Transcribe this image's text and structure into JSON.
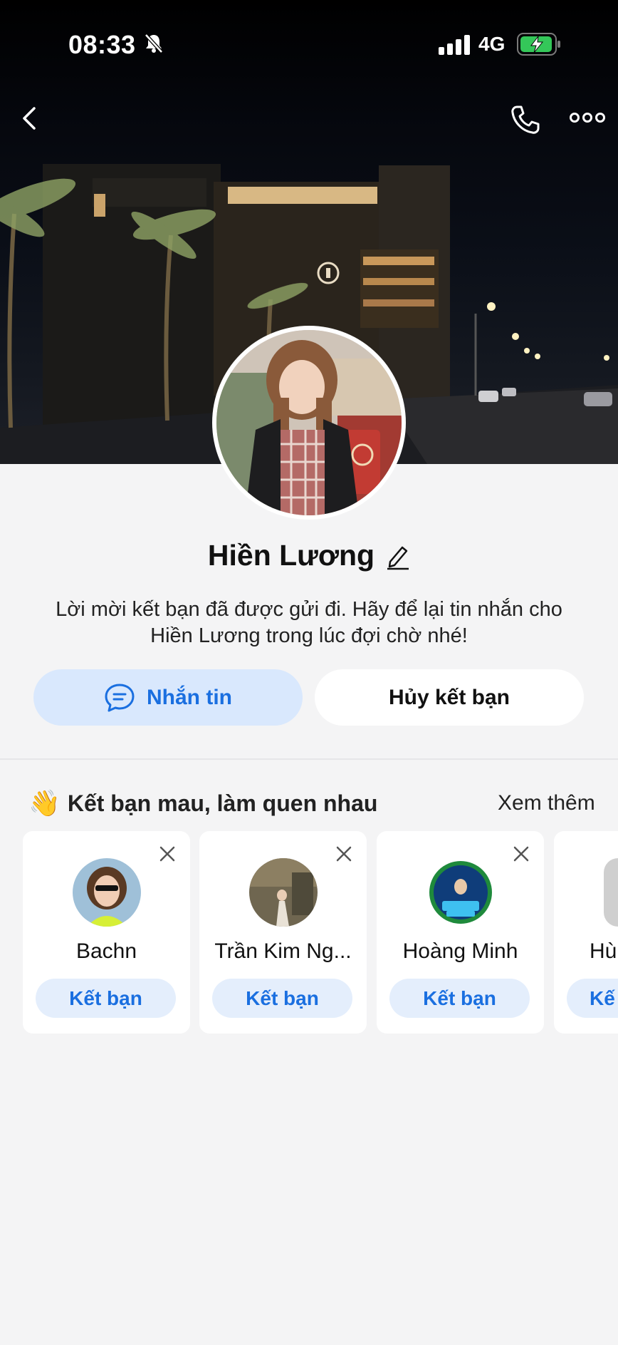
{
  "status_bar": {
    "time": "08:33",
    "network": "4G",
    "icons": [
      "bell-slash-icon",
      "signal-icon",
      "battery-charging-icon"
    ]
  },
  "nav": {
    "back_icon": "chevron-left-icon",
    "call_icon": "phone-icon",
    "more_icon": "more-dots-icon"
  },
  "profile": {
    "name": "Hiền Lương",
    "edit_icon": "pencil-icon",
    "hint": "Lời mời kết bạn đã được gửi đi. Hãy để lại tin nhắn cho Hiền Lương trong lúc đợi chờ nhé!"
  },
  "actions": {
    "message_label": "Nhắn tin",
    "message_icon": "chat-bubble-icon",
    "unfriend_label": "Hủy kết bạn"
  },
  "suggestions": {
    "emoji": "👋",
    "title": "Kết bạn mau, làm quen nhau",
    "see_more": "Xem thêm",
    "cards": [
      {
        "name": "Bachn",
        "button": "Kết bạn"
      },
      {
        "name": "Trần Kim Ng...",
        "button": "Kết bạn"
      },
      {
        "name": "Hoàng Minh",
        "button": "Kết bạn"
      },
      {
        "name": "Hù",
        "button": "Kế"
      }
    ]
  },
  "colors": {
    "accent": "#1a6fe0",
    "accent_soft": "#d9e8fd",
    "background": "#f4f4f5",
    "battery_green": "#34c759"
  }
}
